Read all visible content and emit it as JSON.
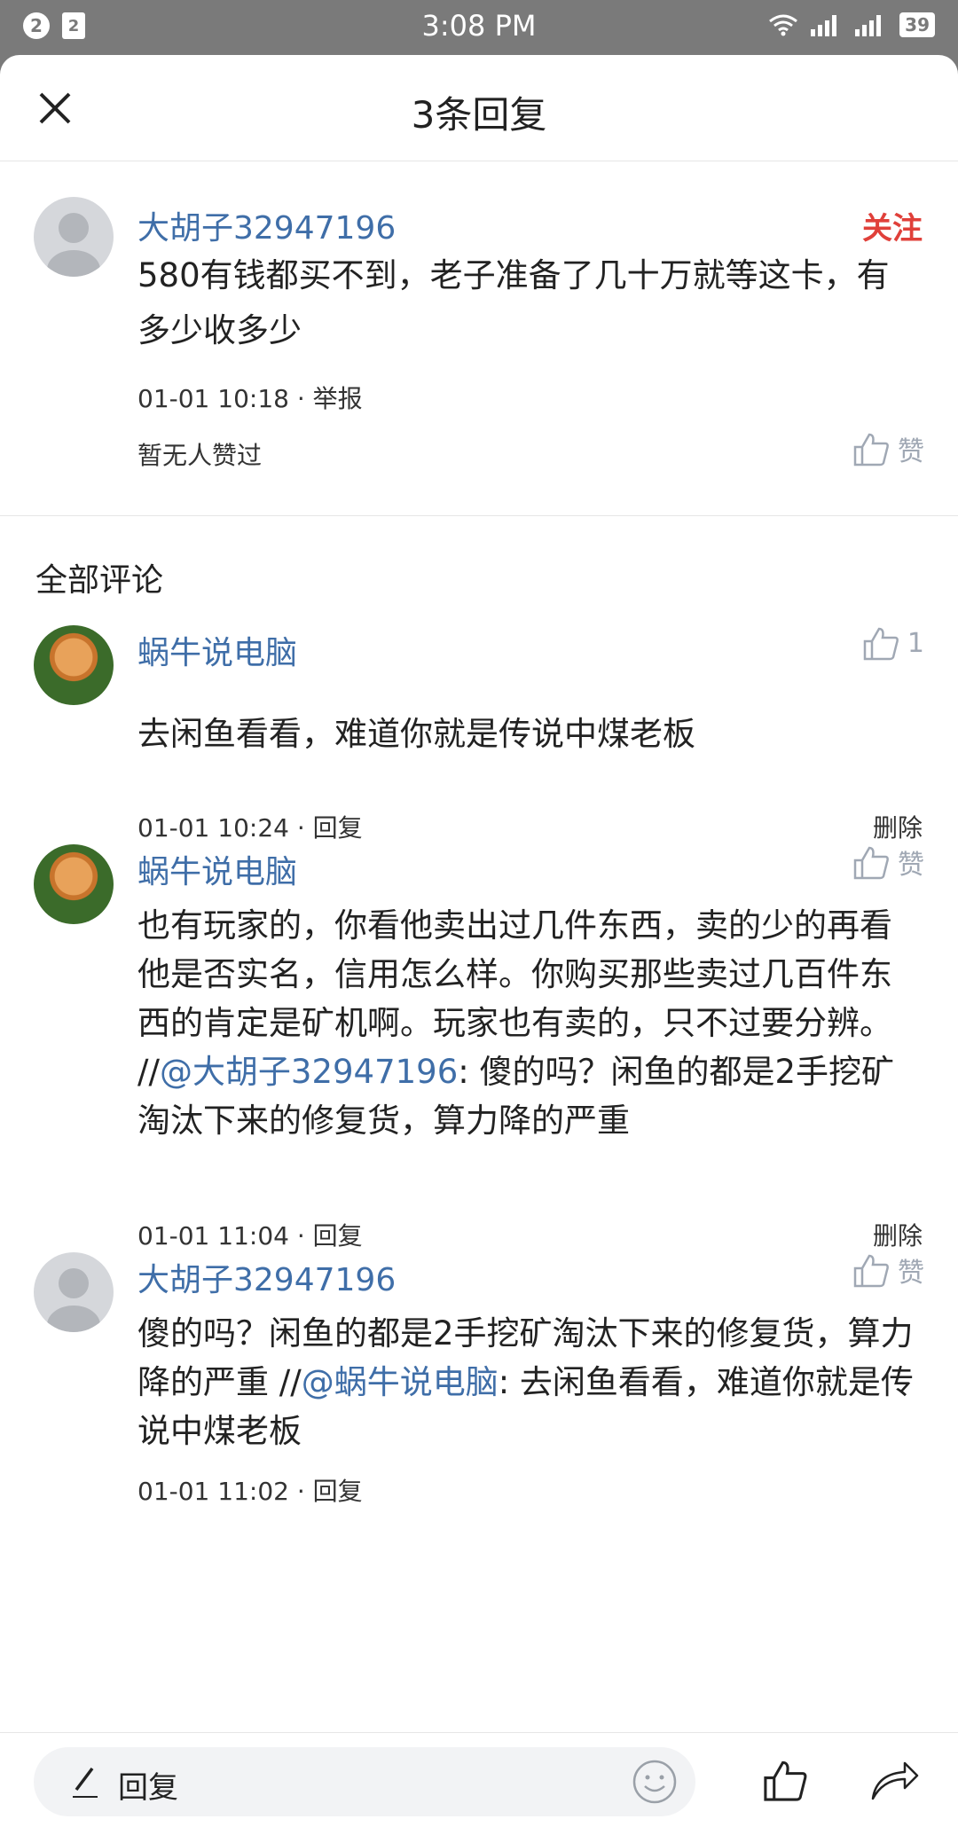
{
  "statusbar": {
    "notif_count": "2",
    "doc_icon": "2",
    "time": "3:08 PM",
    "battery": "39"
  },
  "header": {
    "title": "3条回复"
  },
  "main_comment": {
    "username": "大胡子32947196",
    "follow_label": "关注",
    "text": "580有钱都买不到，老子准备了几十万就等这卡，有多少收多少",
    "meta": "01-01 10:18 · 举报",
    "no_likes": "暂无人赞过",
    "like_label": "赞"
  },
  "section_title": "全部评论",
  "replies": [
    {
      "username": "蜗牛说电脑",
      "like_label": "1",
      "text_before": "去闲鱼看看，难道你就是传说中煤老板",
      "mention": "",
      "text_after": "",
      "meta": "01-01 10:24 · 回复",
      "delete_label": "删除"
    },
    {
      "username": "蜗牛说电脑",
      "like_label": "赞",
      "text_before": "也有玩家的，你看他卖出过几件东西，卖的少的再看他是否实名，信用怎么样。你购买那些卖过几百件东西的肯定是矿机啊。玩家也有卖的，只不过要分辨。 //",
      "mention": "@大胡子32947196",
      "text_after": ": 傻的吗？闲鱼的都是2手挖矿淘汰下来的修复货，算力降的严重",
      "meta": "01-01 11:04 · 回复",
      "delete_label": "删除"
    },
    {
      "username": "大胡子32947196",
      "like_label": "赞",
      "text_before": "傻的吗？闲鱼的都是2手挖矿淘汰下来的修复货，算力降的严重 //",
      "mention": "@蜗牛说电脑",
      "text_after": ": 去闲鱼看看，难道你就是传说中煤老板",
      "meta": "01-01 11:02 · 回复",
      "delete_label": ""
    }
  ],
  "bottombar": {
    "reply_placeholder": "回复"
  },
  "colors": {
    "link": "#3f6ea8",
    "follow": "#e0403a",
    "icon_gray": "#a0a8b4"
  }
}
